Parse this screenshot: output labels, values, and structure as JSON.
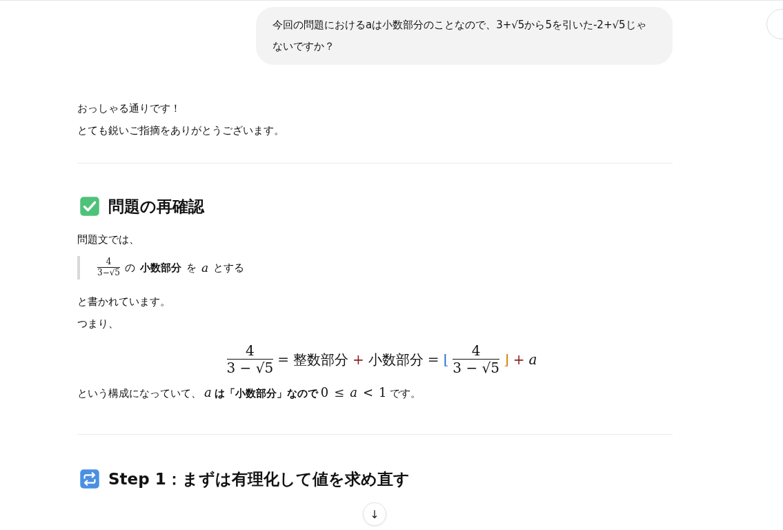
{
  "user_message": {
    "text": "今回の問題におけるaは小数部分のことなので、3+√5から5を引いた-2+√5じゃないですか？"
  },
  "reply": {
    "intro": [
      "おっしゃる通りです！",
      "とても鋭いご指摘をありがとうございます。"
    ],
    "section_1": {
      "heading": "問題の再確認",
      "lead": "問題文では、",
      "quote": [
        {
          "kind": "frac",
          "num": "4",
          "den": "3−√5"
        },
        {
          "kind": "text",
          "text": "の"
        },
        {
          "kind": "bold",
          "text": "小数部分"
        },
        {
          "kind": "text",
          "text": "を"
        },
        {
          "kind": "var",
          "text": "a"
        },
        {
          "kind": "text",
          "text": "とする"
        }
      ],
      "after": [
        "と書かれています。",
        "つまり、"
      ],
      "equation": [
        {
          "kind": "frac",
          "num": "4",
          "den": "3 − √5"
        },
        {
          "kind": "op",
          "text": "=",
          "color": "#222222"
        },
        {
          "kind": "text",
          "text": "整数部分"
        },
        {
          "kind": "op",
          "text": "+",
          "color": "#8b1c1c"
        },
        {
          "kind": "text",
          "text": "小数部分"
        },
        {
          "kind": "op",
          "text": "=",
          "color": "#222222"
        },
        {
          "kind": "op",
          "text": "⌊",
          "color": "#1f6fd1"
        },
        {
          "kind": "frac",
          "num": "4",
          "den": "3 − √5"
        },
        {
          "kind": "op",
          "text": "⌋",
          "color": "#d97a00"
        },
        {
          "kind": "op",
          "text": "+",
          "color": "#8b1c1c"
        },
        {
          "kind": "var",
          "text": "a"
        }
      ],
      "conclusion": [
        {
          "kind": "text",
          "text": "という構成になっていて、"
        },
        {
          "kind": "var",
          "text": "a"
        },
        {
          "kind": "bold",
          "text": "は「小数部分」なので"
        },
        {
          "kind": "math",
          "text": "0"
        },
        {
          "kind": "op",
          "text": "≤",
          "color": "#222222"
        },
        {
          "kind": "var",
          "text": "a"
        },
        {
          "kind": "op",
          "text": "<",
          "color": "#222222"
        },
        {
          "kind": "math",
          "text": "1"
        },
        {
          "kind": "text",
          "text": "です。"
        }
      ]
    },
    "section_2": {
      "heading": "Step 1：まずは有理化して値を求め直す"
    }
  },
  "scroll_button": {
    "label": "↓"
  }
}
